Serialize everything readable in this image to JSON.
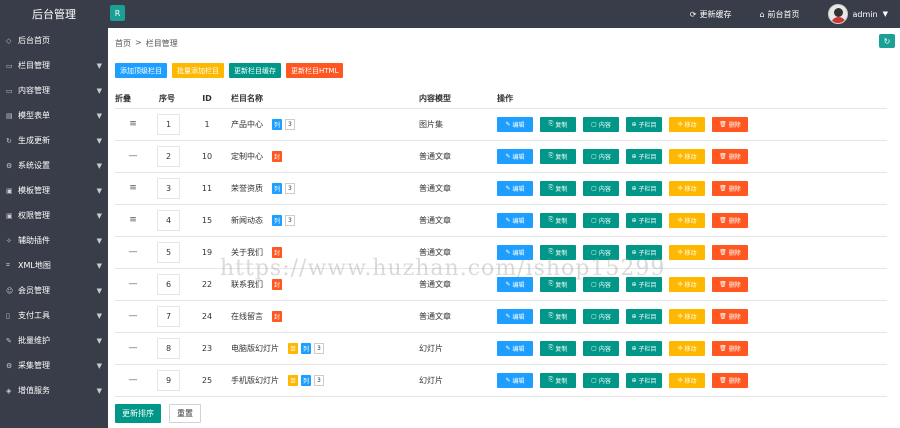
{
  "header": {
    "brand": "后台管理",
    "toggle_icon": "R",
    "links": [
      {
        "icon": "refresh-icon",
        "glyph": "⟳",
        "label": "更新缓存"
      },
      {
        "icon": "home-icon",
        "glyph": "⌂",
        "label": "前台首页"
      }
    ],
    "user": "admin",
    "caret": "▼"
  },
  "sidebar": {
    "items": [
      {
        "label": "后台首页",
        "glyph": "◇",
        "has_chevron": false
      },
      {
        "label": "栏目管理",
        "glyph": "▭",
        "has_chevron": true
      },
      {
        "label": "内容管理",
        "glyph": "▭",
        "has_chevron": true
      },
      {
        "label": "模型表单",
        "glyph": "▤",
        "has_chevron": true
      },
      {
        "label": "生成更新",
        "glyph": "↻",
        "has_chevron": true
      },
      {
        "label": "系统设置",
        "glyph": "⚙",
        "has_chevron": true
      },
      {
        "label": "模板管理",
        "glyph": "▣",
        "has_chevron": true
      },
      {
        "label": "权限管理",
        "glyph": "▣",
        "has_chevron": true
      },
      {
        "label": "辅助插件",
        "glyph": "✧",
        "has_chevron": true
      },
      {
        "label": "XML地图",
        "glyph": "⌗",
        "has_chevron": true
      },
      {
        "label": "会员管理",
        "glyph": "☺",
        "has_chevron": true
      },
      {
        "label": "支付工具",
        "glyph": "▯",
        "has_chevron": true
      },
      {
        "label": "批量维护",
        "glyph": "✎",
        "has_chevron": true
      },
      {
        "label": "采集管理",
        "glyph": "⚙",
        "has_chevron": true
      },
      {
        "label": "增值服务",
        "glyph": "◈",
        "has_chevron": true
      }
    ],
    "chevron": "▼"
  },
  "breadcrumb": {
    "home": "首页",
    "sep": ">",
    "current": "栏目管理"
  },
  "corner_icon": "↻",
  "actions": [
    {
      "label": "添加顶级栏目",
      "color": "blue"
    },
    {
      "label": "批量添加栏目",
      "color": "yellow"
    },
    {
      "label": "更新栏目缓存",
      "color": "green"
    },
    {
      "label": "更新栏目HTML",
      "color": "red"
    }
  ],
  "table": {
    "headers": {
      "fold": "折叠",
      "sort": "序号",
      "id": "ID",
      "name": "栏目名称",
      "model": "内容模型",
      "ops": "操作"
    },
    "rows": [
      {
        "fold": "≡",
        "sort": "1",
        "id": "1",
        "name": "产品中心",
        "tags": [
          {
            "t": "列",
            "c": "blue"
          }
        ],
        "count": "3",
        "model": "图片集"
      },
      {
        "fold": "—",
        "sort": "2",
        "id": "10",
        "name": "定制中心",
        "tags": [
          {
            "t": "封",
            "c": "orange"
          }
        ],
        "count": "",
        "model": "普通文章"
      },
      {
        "fold": "≡",
        "sort": "3",
        "id": "11",
        "name": "荣誉资质",
        "tags": [
          {
            "t": "列",
            "c": "blue"
          }
        ],
        "count": "3",
        "model": "普通文章"
      },
      {
        "fold": "≡",
        "sort": "4",
        "id": "15",
        "name": "新闻动态",
        "tags": [
          {
            "t": "列",
            "c": "blue"
          }
        ],
        "count": "3",
        "model": "普通文章"
      },
      {
        "fold": "—",
        "sort": "5",
        "id": "19",
        "name": "关于我们",
        "tags": [
          {
            "t": "封",
            "c": "orange"
          }
        ],
        "count": "",
        "model": "普通文章"
      },
      {
        "fold": "—",
        "sort": "6",
        "id": "22",
        "name": "联系我们",
        "tags": [
          {
            "t": "封",
            "c": "orange"
          }
        ],
        "count": "",
        "model": "普通文章"
      },
      {
        "fold": "—",
        "sort": "7",
        "id": "24",
        "name": "在线留言",
        "tags": [
          {
            "t": "封",
            "c": "orange"
          }
        ],
        "count": "",
        "model": "普通文章"
      },
      {
        "fold": "—",
        "sort": "8",
        "id": "23",
        "name": "电脑版幻灯片",
        "tags": [
          {
            "t": "单",
            "c": "yellow"
          },
          {
            "t": "列",
            "c": "blue"
          }
        ],
        "count": "3",
        "model": "幻灯片"
      },
      {
        "fold": "—",
        "sort": "9",
        "id": "25",
        "name": "手机版幻灯片",
        "tags": [
          {
            "t": "单",
            "c": "yellow"
          },
          {
            "t": "列",
            "c": "blue"
          }
        ],
        "count": "3",
        "model": "幻灯片"
      }
    ],
    "ops": [
      {
        "label": "编辑",
        "glyph": "✎",
        "color": "blue",
        "icon": "edit-icon"
      },
      {
        "label": "复制",
        "glyph": "⎘",
        "color": "green",
        "icon": "copy-icon"
      },
      {
        "label": "内容",
        "glyph": "▢",
        "color": "green",
        "icon": "content-icon"
      },
      {
        "label": "子栏目",
        "glyph": "⊕",
        "color": "green",
        "icon": "subcategory-icon"
      },
      {
        "label": "移动",
        "glyph": "✣",
        "color": "yellow",
        "icon": "move-icon"
      },
      {
        "label": "删除",
        "glyph": "🗑",
        "color": "red",
        "icon": "delete-icon"
      }
    ]
  },
  "footer": {
    "save": "更新排序",
    "reset": "重置"
  },
  "watermark": "https://www.huzhan.com/ishop15299",
  "colors": {
    "sidebar": "#393d49",
    "green": "#009688",
    "blue": "#1e9fff",
    "yellow": "#ffb800",
    "red": "#ff5722"
  }
}
